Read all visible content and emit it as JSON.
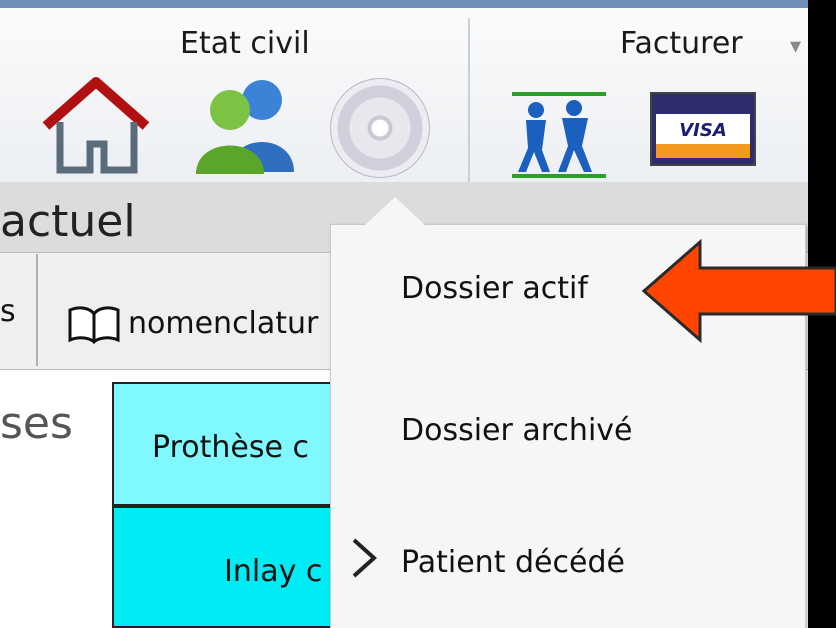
{
  "ribbon": {
    "group1_title": "Etat civil",
    "group2_title": "Facturer",
    "icons": [
      "home-icon",
      "users-icon",
      "disc-icon",
      "people-icon",
      "visa-card-icon"
    ]
  },
  "header": {
    "title_partial": "actuel"
  },
  "toolbar": {
    "left_partial": "s",
    "nomenclature_partial": "nomenclatur"
  },
  "left": {
    "partial_text": "ses"
  },
  "table": {
    "rows": [
      {
        "label_partial": "Prothèse c"
      },
      {
        "label_partial": "Inlay c"
      }
    ]
  },
  "menu": {
    "items": [
      {
        "label": "Dossier actif"
      },
      {
        "label": "Dossier archivé"
      },
      {
        "label": "Patient décédé"
      }
    ]
  },
  "colors": {
    "arrow": "#ff4500",
    "cell_light": "#7ff8ff",
    "cell_dark": "#00ecf4",
    "house_roof": "#b01010"
  }
}
